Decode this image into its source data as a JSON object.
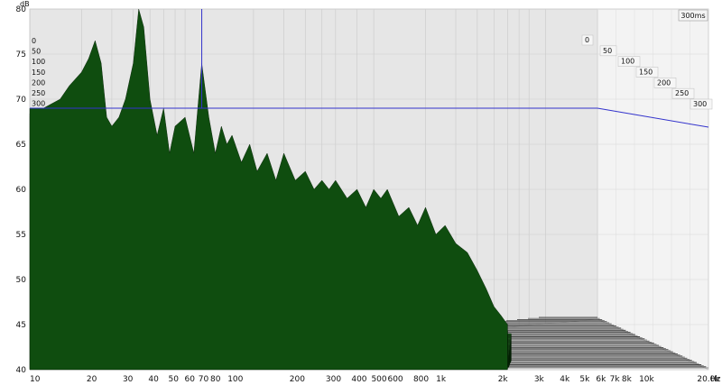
{
  "window": {
    "badge_label": "300ms"
  },
  "chart_data": {
    "type": "area",
    "title": "",
    "subtitle": "",
    "xlabel": "Hz",
    "ylabel": "dB",
    "x_scale": "log",
    "xlim": [
      10,
      20000
    ],
    "ylim": [
      40,
      80
    ],
    "grid": true,
    "cursor": {
      "x": 100,
      "y": 69
    },
    "colors": {
      "fill": "#0f4d0f",
      "edge": "#051f05",
      "cursor": "#3333cc",
      "back_panel": "#e6e6e6",
      "floor": "#f2f2f2"
    },
    "x_tick_labels": [
      "10",
      "20",
      "30",
      "40",
      "50",
      "60",
      "70",
      "80",
      "100",
      "200",
      "300",
      "400",
      "500",
      "600",
      "800",
      "1k",
      "2k",
      "3k",
      "4k",
      "5k",
      "6k",
      "7k",
      "8k",
      "10k",
      "20.0k"
    ],
    "x_tick_values": [
      10,
      20,
      30,
      40,
      50,
      60,
      70,
      80,
      100,
      200,
      300,
      400,
      500,
      600,
      800,
      1000,
      2000,
      3000,
      4000,
      5000,
      6000,
      7000,
      8000,
      10000,
      20000
    ],
    "y_tick_labels": [
      "40",
      "45",
      "50",
      "55",
      "60",
      "65",
      "70",
      "75",
      "80"
    ],
    "y_tick_values": [
      40,
      45,
      50,
      55,
      60,
      65,
      70,
      75,
      80
    ],
    "time_axis": {
      "unit": "ms",
      "labels": [
        "0",
        "50",
        "100",
        "150",
        "200",
        "250",
        "300"
      ],
      "values": [
        0,
        50,
        100,
        150,
        200,
        250,
        300
      ]
    },
    "series": [
      {
        "name": "0",
        "x": [
          10,
          12,
          15,
          17,
          20,
          22,
          24,
          26,
          28,
          30,
          33,
          36,
          40,
          43,
          46,
          50,
          55,
          60,
          65,
          70,
          80,
          90,
          100,
          110,
          120,
          130,
          140,
          150,
          170,
          190,
          210,
          240,
          270,
          300,
          350,
          400,
          450,
          500,
          550,
          600,
          700,
          800,
          900,
          1000,
          1100,
          1200,
          1400,
          1600,
          1800,
          2000,
          2300,
          2600,
          3000,
          3500,
          4000,
          4500,
          5000,
          5500,
          6000
        ],
        "y": [
          69,
          69,
          70,
          71.5,
          73,
          74.5,
          76.5,
          74,
          68,
          67,
          68,
          70,
          74,
          80,
          78,
          70,
          66,
          69,
          64,
          67,
          68,
          64,
          74,
          68,
          64,
          67,
          65,
          66,
          63,
          65,
          62,
          64,
          61,
          64,
          61,
          62,
          60,
          61,
          60,
          61,
          59,
          60,
          58,
          60,
          59,
          60,
          57,
          58,
          56,
          58,
          55,
          56,
          54,
          53,
          51,
          49,
          47,
          46,
          45
        ]
      }
    ]
  }
}
